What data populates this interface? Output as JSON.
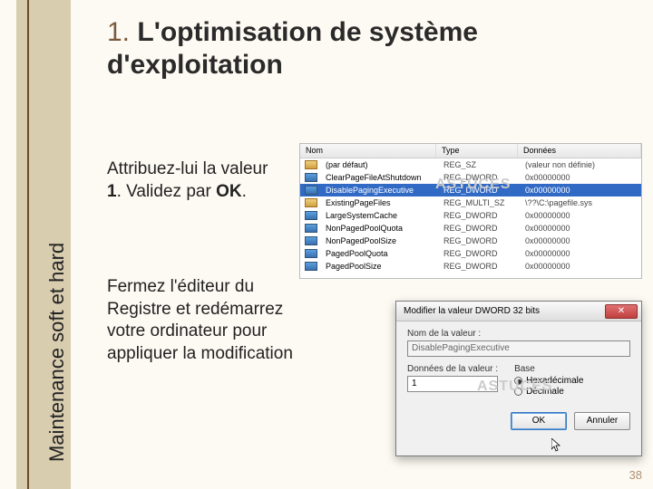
{
  "sidebar_label": "Maintenance soft et hard",
  "title_number": "1.",
  "title_text": "L'optimisation de système d'exploitation",
  "para1_a": "Attribuez-lui la valeur ",
  "para1_bold1": "1",
  "para1_b": ". Validez par ",
  "para1_bold2": "OK",
  "para1_c": ".",
  "para2": "Fermez l'éditeur du Registre et redémarrez votre ordinateur pour appliquer la modification",
  "page_number": "38",
  "watermark": "ASTUCES",
  "registry": {
    "columns": {
      "name": "Nom",
      "type": "Type",
      "data": "Données"
    },
    "rows": [
      {
        "name": "(par défaut)",
        "type": "REG_SZ",
        "data": "(valeur non définie)",
        "str": true
      },
      {
        "name": "ClearPageFileAtShutdown",
        "type": "REG_DWORD",
        "data": "0x00000000"
      },
      {
        "name": "DisablePagingExecutive",
        "type": "REG_DWORD",
        "data": "0x00000000",
        "selected": true
      },
      {
        "name": "ExistingPageFiles",
        "type": "REG_MULTI_SZ",
        "data": "\\??\\C:\\pagefile.sys",
        "str": true
      },
      {
        "name": "LargeSystemCache",
        "type": "REG_DWORD",
        "data": "0x00000000"
      },
      {
        "name": "NonPagedPoolQuota",
        "type": "REG_DWORD",
        "data": "0x00000000"
      },
      {
        "name": "NonPagedPoolSize",
        "type": "REG_DWORD",
        "data": "0x00000000"
      },
      {
        "name": "PagedPoolQuota",
        "type": "REG_DWORD",
        "data": "0x00000000"
      },
      {
        "name": "PagedPoolSize",
        "type": "REG_DWORD",
        "data": "0x00000000"
      }
    ]
  },
  "dialog": {
    "title": "Modifier la valeur DWORD 32 bits",
    "name_label": "Nom de la valeur :",
    "name_value": "DisablePagingExecutive",
    "data_label": "Données de la valeur :",
    "data_value": "1",
    "base_label": "Base",
    "radio_hex": "Hexadécimale",
    "radio_dec": "Décimale",
    "ok": "OK",
    "cancel": "Annuler"
  }
}
